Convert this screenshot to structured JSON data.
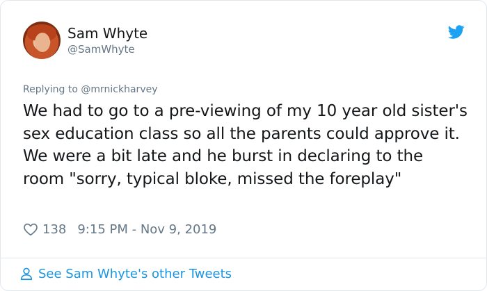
{
  "author": {
    "display_name": "Sam Whyte",
    "handle": "@SamWhyte"
  },
  "reply": {
    "prefix": "Replying to ",
    "mention": "@mrnickharvey"
  },
  "tweet": {
    "text": "We had to go to a pre-viewing of my 10 year old sister's sex education class so all the parents could approve it. We were a bit late and he burst in declaring to the room \"sorry, typical bloke, missed the foreplay\""
  },
  "meta": {
    "likes": "138",
    "timestamp": "9:15 PM - Nov 9, 2019"
  },
  "footer": {
    "link_label": "See Sam Whyte's other Tweets"
  },
  "colors": {
    "twitter_blue": "#1b95e0",
    "secondary_text": "#657786",
    "border": "#e1e8ed"
  },
  "icons": [
    "twitter-bird-icon",
    "heart-icon",
    "person-icon"
  ]
}
